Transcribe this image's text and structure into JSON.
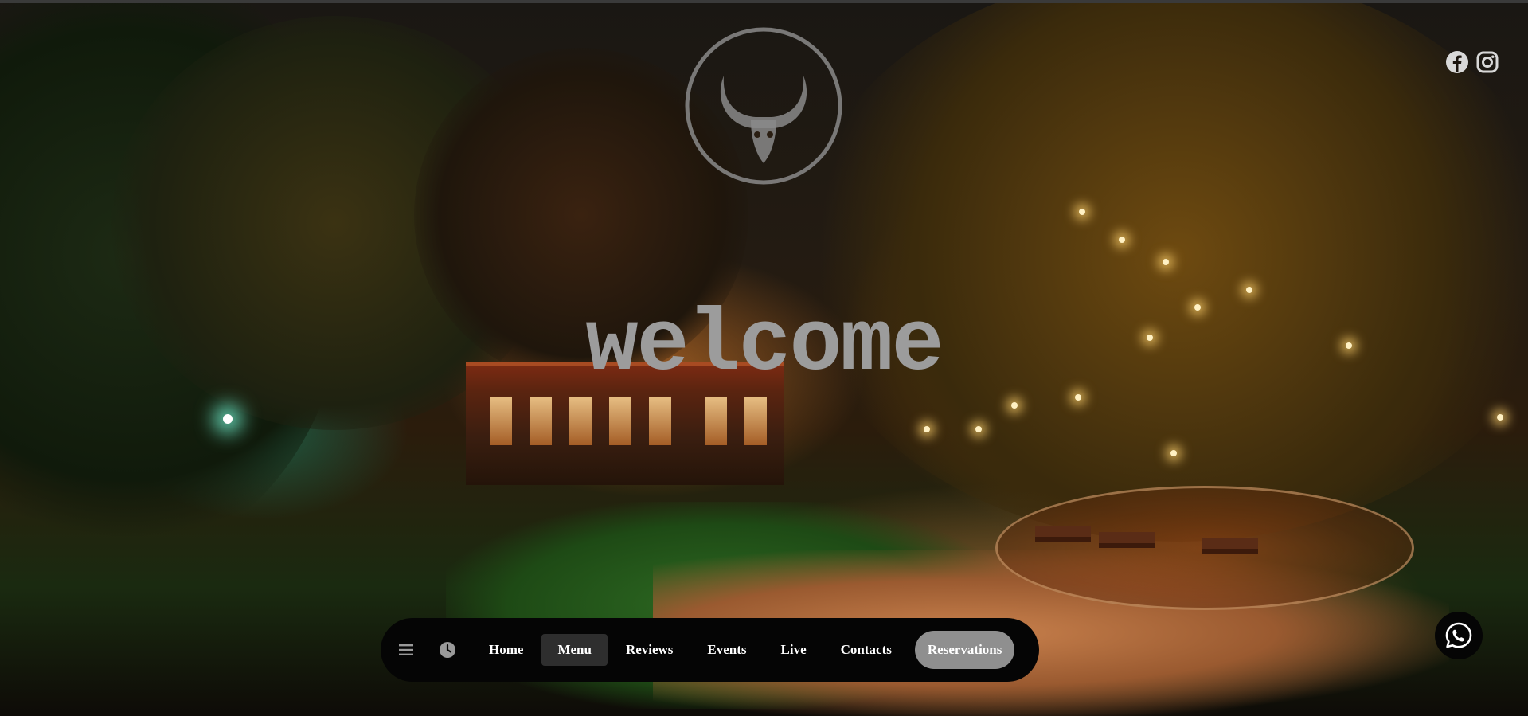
{
  "hero": {
    "headline": "welcome",
    "logo_icon": "bull-skull-logo"
  },
  "social": {
    "links": [
      {
        "icon": "facebook-icon"
      },
      {
        "icon": "instagram-icon"
      }
    ]
  },
  "nav": {
    "menu_icon": "hamburger-icon",
    "hours_icon": "clock-icon",
    "items": [
      {
        "label": "Home"
      },
      {
        "label": "Menu",
        "active": true
      },
      {
        "label": "Reviews"
      },
      {
        "label": "Events"
      },
      {
        "label": "Live"
      },
      {
        "label": "Contacts"
      }
    ],
    "cta": {
      "label": "Reservations"
    }
  },
  "whatsapp": {
    "icon": "whatsapp-icon"
  },
  "colors": {
    "nav_background": "#050505",
    "nav_active": "#2e2e2e",
    "cta_background": "#8f8f8f",
    "headline": "#9c9c9c",
    "logo_stroke": "#8a8a8a"
  }
}
